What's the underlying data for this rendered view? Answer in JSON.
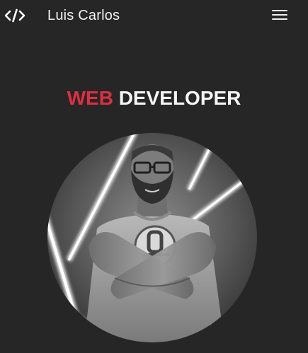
{
  "navbar": {
    "logo_icon": "code-brackets-icon",
    "brand": "Luis Carlos",
    "menu_icon": "hamburger-menu-icon"
  },
  "hero": {
    "title_accent": "WEB",
    "title_rest": "DEVELOPER",
    "accent_color": "#dd2f42",
    "portrait_icon": "profile-photo"
  }
}
